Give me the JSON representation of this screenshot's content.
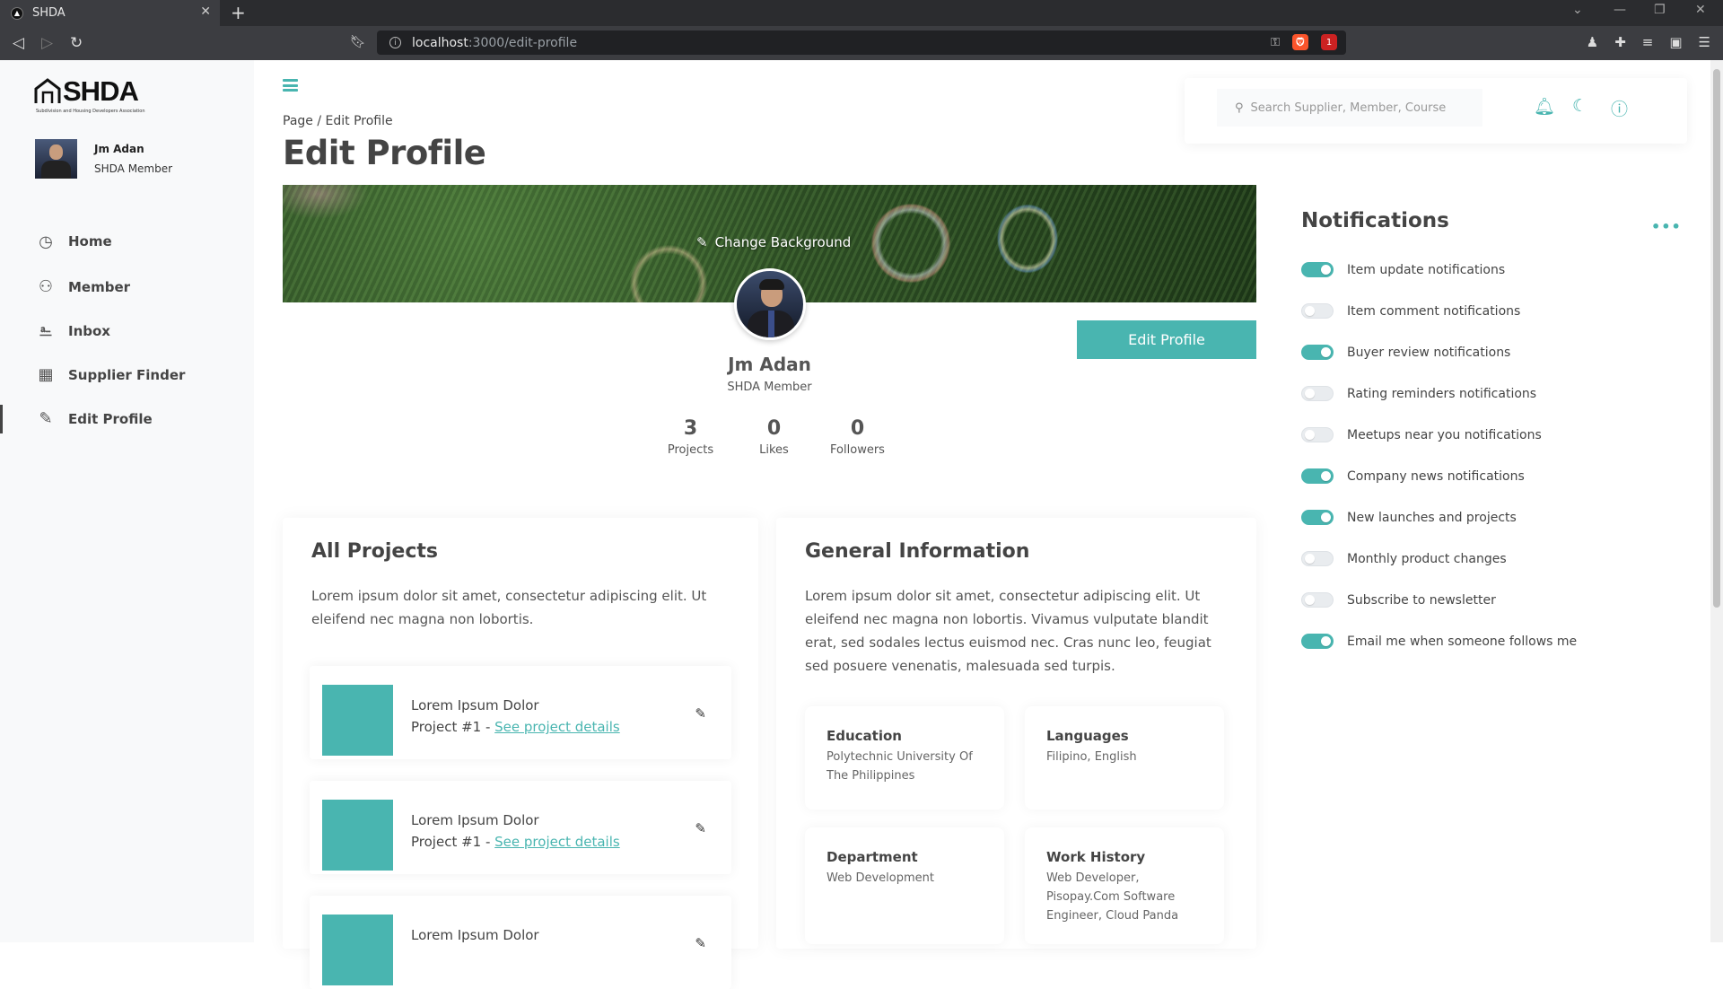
{
  "browser": {
    "tab_title": "SHDA",
    "url_host": "localhost",
    "url_path": ":3000/edit-profile",
    "brave_badge": "1"
  },
  "sidebar": {
    "logo_text": "SHDA",
    "logo_sub": "Subdivision and Housing Developers Association",
    "user_name": "Jm Adan",
    "user_role": "SHDA Member",
    "nav": [
      {
        "label": "Home",
        "icon": "gauge-icon"
      },
      {
        "label": "Member",
        "icon": "users-icon"
      },
      {
        "label": "Inbox",
        "icon": "inbox-icon"
      },
      {
        "label": "Supplier Finder",
        "icon": "store-icon"
      },
      {
        "label": "Edit Profile",
        "icon": "edit-icon"
      }
    ]
  },
  "header": {
    "breadcrumb": "Page / Edit Profile",
    "title": "Edit Profile",
    "search_placeholder": "Search Supplier, Member, Course"
  },
  "profile": {
    "change_bg_label": "Change Background",
    "edit_button": "Edit Profile",
    "name": "Jm Adan",
    "role": "SHDA Member",
    "stats": [
      {
        "value": "3",
        "label": "Projects"
      },
      {
        "value": "0",
        "label": "Likes"
      },
      {
        "value": "0",
        "label": "Followers"
      }
    ]
  },
  "projects": {
    "title": "All Projects",
    "description": "Lorem ipsum dolor sit amet, consectetur adipiscing elit. Ut eleifend nec magna non lobortis.",
    "items": [
      {
        "title": "Lorem Ipsum Dolor",
        "prefix": "Project #1 - ",
        "link": "See project details"
      },
      {
        "title": "Lorem Ipsum Dolor",
        "prefix": "Project #1 - ",
        "link": "See project details"
      },
      {
        "title": "Lorem Ipsum Dolor",
        "prefix": "",
        "link": ""
      }
    ]
  },
  "general": {
    "title": "General Information",
    "description": "Lorem ipsum dolor sit amet, consectetur adipiscing elit. Ut eleifend nec magna non lobortis. Vivamus vulputate blandit erat, sed sodales lectus euismod nec. Cras nunc leo, feugiat sed posuere venenatis, malesuada sed turpis.",
    "fields": [
      {
        "label": "Education",
        "value": "Polytechnic University Of The Philippines"
      },
      {
        "label": "Languages",
        "value": "Filipino, English"
      },
      {
        "label": "Department",
        "value": "Web Development"
      },
      {
        "label": "Work History",
        "value": "Web Developer, Pisopay.Com Software Engineer, Cloud Panda"
      }
    ]
  },
  "notifications": {
    "title": "Notifications",
    "more": "•••",
    "items": [
      {
        "label": "Item update notifications",
        "on": true
      },
      {
        "label": "Item comment notifications",
        "on": false
      },
      {
        "label": "Buyer review notifications",
        "on": true
      },
      {
        "label": "Rating reminders notifications",
        "on": false
      },
      {
        "label": "Meetups near you notifications",
        "on": false
      },
      {
        "label": "Company news notifications",
        "on": true
      },
      {
        "label": "New launches and projects",
        "on": true
      },
      {
        "label": "Monthly product changes",
        "on": false
      },
      {
        "label": "Subscribe to newsletter",
        "on": false
      },
      {
        "label": "Email me when someone follows me",
        "on": true
      }
    ]
  },
  "colors": {
    "accent": "#49b5b0",
    "sidebar_bg": "#f8f9fa"
  }
}
